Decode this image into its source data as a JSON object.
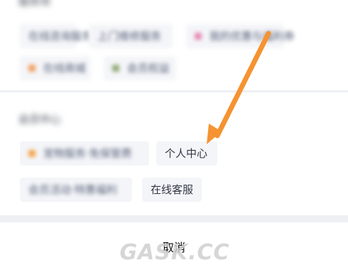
{
  "partial_section": {
    "title": "服务项",
    "chips": [
      {
        "label": "在线咨询服务"
      },
      {
        "label": "上门维修服务"
      },
      {
        "label": "我的优惠与福利券"
      },
      {
        "label": "在线商城"
      },
      {
        "label": "会员权益"
      }
    ]
  },
  "member_section": {
    "title": "会员中心",
    "chips": [
      {
        "label": "宠物服务·免保管费"
      },
      {
        "label": "个人中心"
      },
      {
        "label": "会员活动·特惠福利"
      },
      {
        "label": "在线客服"
      }
    ]
  },
  "footer": {
    "cancel_label": "取消"
  },
  "watermark": {
    "text": "GASK.CC"
  },
  "annotation": {
    "color": "#f59331",
    "icon": "arrow-pointer-icon"
  }
}
